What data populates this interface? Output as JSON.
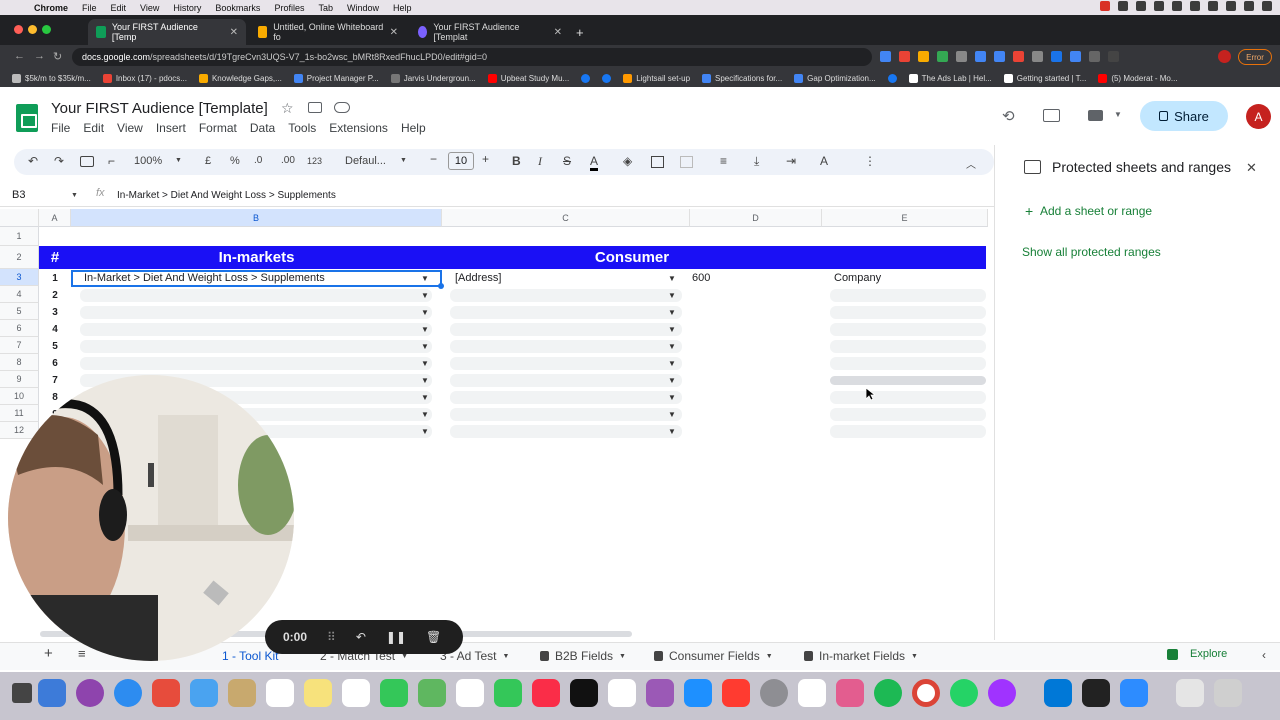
{
  "menubar": {
    "app": "Chrome",
    "items": [
      "File",
      "Edit",
      "View",
      "History",
      "Bookmarks",
      "Profiles",
      "Tab",
      "Window",
      "Help"
    ]
  },
  "browser": {
    "tabs": [
      {
        "title": "Your FIRST Audience [Temp",
        "active": true,
        "color": "#0f9d58"
      },
      {
        "title": "Untitled, Online Whiteboard fo",
        "active": false,
        "color": "#f9ab00"
      },
      {
        "title": "Your FIRST Audience [Templat",
        "active": false,
        "color": "#7b61ff"
      }
    ],
    "url_host": "docs.google.com",
    "url_path": "/spreadsheets/d/19TgreCvn3UQS-V7_1s-bo2wsc_bMRt8RxedFhucLPD0/edit#gid=0",
    "error_label": "Error",
    "bookmarks": [
      {
        "label": "$5k/m to $35k/m...",
        "color": "#bbbbbb"
      },
      {
        "label": "Inbox (17) - pdocs...",
        "color": "#ea4335"
      },
      {
        "label": "Knowledge Gaps,...",
        "color": "#f9ab00"
      },
      {
        "label": "Project Manager P...",
        "color": "#4285f4"
      },
      {
        "label": "Jarvis Undergroun...",
        "color": "#777777"
      },
      {
        "label": "Upbeat Study Mu...",
        "color": "#ff0000"
      },
      {
        "label": "",
        "color": "#1877f2"
      },
      {
        "label": "",
        "color": "#1877f2"
      },
      {
        "label": "Lightsail set-up",
        "color": "#ff9900"
      },
      {
        "label": "Specifications for...",
        "color": "#4285f4"
      },
      {
        "label": "Gap Optimization...",
        "color": "#4285f4"
      },
      {
        "label": "",
        "color": "#1877f2"
      },
      {
        "label": "The Ads Lab | Hel...",
        "color": "#222222"
      },
      {
        "label": "Getting started | T...",
        "color": "#222222"
      },
      {
        "label": "(5) Moderat - Mo...",
        "color": "#ff0000"
      }
    ]
  },
  "sheets": {
    "title": "Your FIRST Audience [Template]",
    "menus": [
      "File",
      "Edit",
      "View",
      "Insert",
      "Format",
      "Data",
      "Tools",
      "Extensions",
      "Help"
    ],
    "share_label": "Share",
    "avatar_letter": "A",
    "toolbar": {
      "zoom": "100%",
      "currency": "£",
      "percent": "%",
      "dec_less": ".0",
      "dec_more": ".00",
      "number_format": "123",
      "font": "Defaul...",
      "font_size": "10",
      "bold": "B",
      "italic": "I",
      "text_color": "A"
    },
    "name_box": "B3",
    "fx": "fx",
    "formula": "In-Market > Diet And Weight Loss > Supplements"
  },
  "grid": {
    "columns": [
      "A",
      "B",
      "C",
      "D",
      "E"
    ],
    "rows": [
      "1",
      "2",
      "3",
      "4",
      "5",
      "6",
      "7",
      "8",
      "9",
      "10",
      "11",
      "12"
    ],
    "header_hash": "#",
    "header_inmarkets": "In-markets",
    "header_consumer": "Consumer",
    "numbers": [
      "1",
      "2",
      "3",
      "4",
      "5",
      "6",
      "7",
      "8",
      "9"
    ],
    "first_row": {
      "inmarket": "In-Market > Diet And Weight Loss > Supplements",
      "consumer": "[Address]",
      "value": "600",
      "type": "Company"
    }
  },
  "panel": {
    "title": "Protected sheets and ranges",
    "add_label": "Add a sheet or range",
    "show_all_label": "Show all protected ranges"
  },
  "sheet_tabs": [
    {
      "label": "1 - Tool Kit",
      "locked": false,
      "active": true
    },
    {
      "label": "2 - Match Test",
      "locked": false,
      "active": false
    },
    {
      "label": "3 - Ad Test",
      "locked": false,
      "active": false
    },
    {
      "label": "B2B Fields",
      "locked": true,
      "active": false
    },
    {
      "label": "Consumer Fields",
      "locked": true,
      "active": false
    },
    {
      "label": "In-market Fields",
      "locked": true,
      "active": false
    }
  ],
  "explore_label": "Explore",
  "recorder": {
    "time": "0:00"
  },
  "colors": {
    "header_blue": "#1a10f5",
    "sheets_green": "#0f9d58",
    "share_bg": "#c2e7ff",
    "selection": "#1a73e8"
  }
}
